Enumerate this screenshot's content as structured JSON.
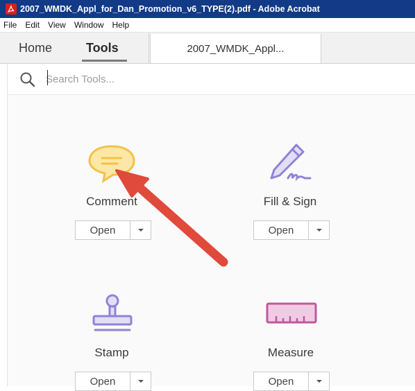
{
  "window": {
    "title": "2007_WMDK_Appl_for_Dan_Promotion_v6_TYPE(2).pdf - Adobe Acrobat"
  },
  "menu": [
    "File",
    "Edit",
    "View",
    "Window",
    "Help"
  ],
  "tabs": {
    "home": "Home",
    "tools": "Tools",
    "document": "2007_WMDK_Appl..."
  },
  "search": {
    "placeholder": "Search Tools..."
  },
  "tools": [
    {
      "label": "Comment",
      "button": "Open",
      "icon": "comment-icon",
      "color": "#f5c84c"
    },
    {
      "label": "Fill & Sign",
      "button": "Open",
      "icon": "fill-sign-icon",
      "color": "#8f83d6"
    },
    {
      "label": "Stamp",
      "button": "Open",
      "icon": "stamp-icon",
      "color": "#8f83d6"
    },
    {
      "label": "Measure",
      "button": "Open",
      "icon": "measure-icon",
      "color": "#c2579e"
    }
  ],
  "annotation": {
    "type": "arrow",
    "color": "#e04a3b",
    "points_to": "Comment"
  }
}
